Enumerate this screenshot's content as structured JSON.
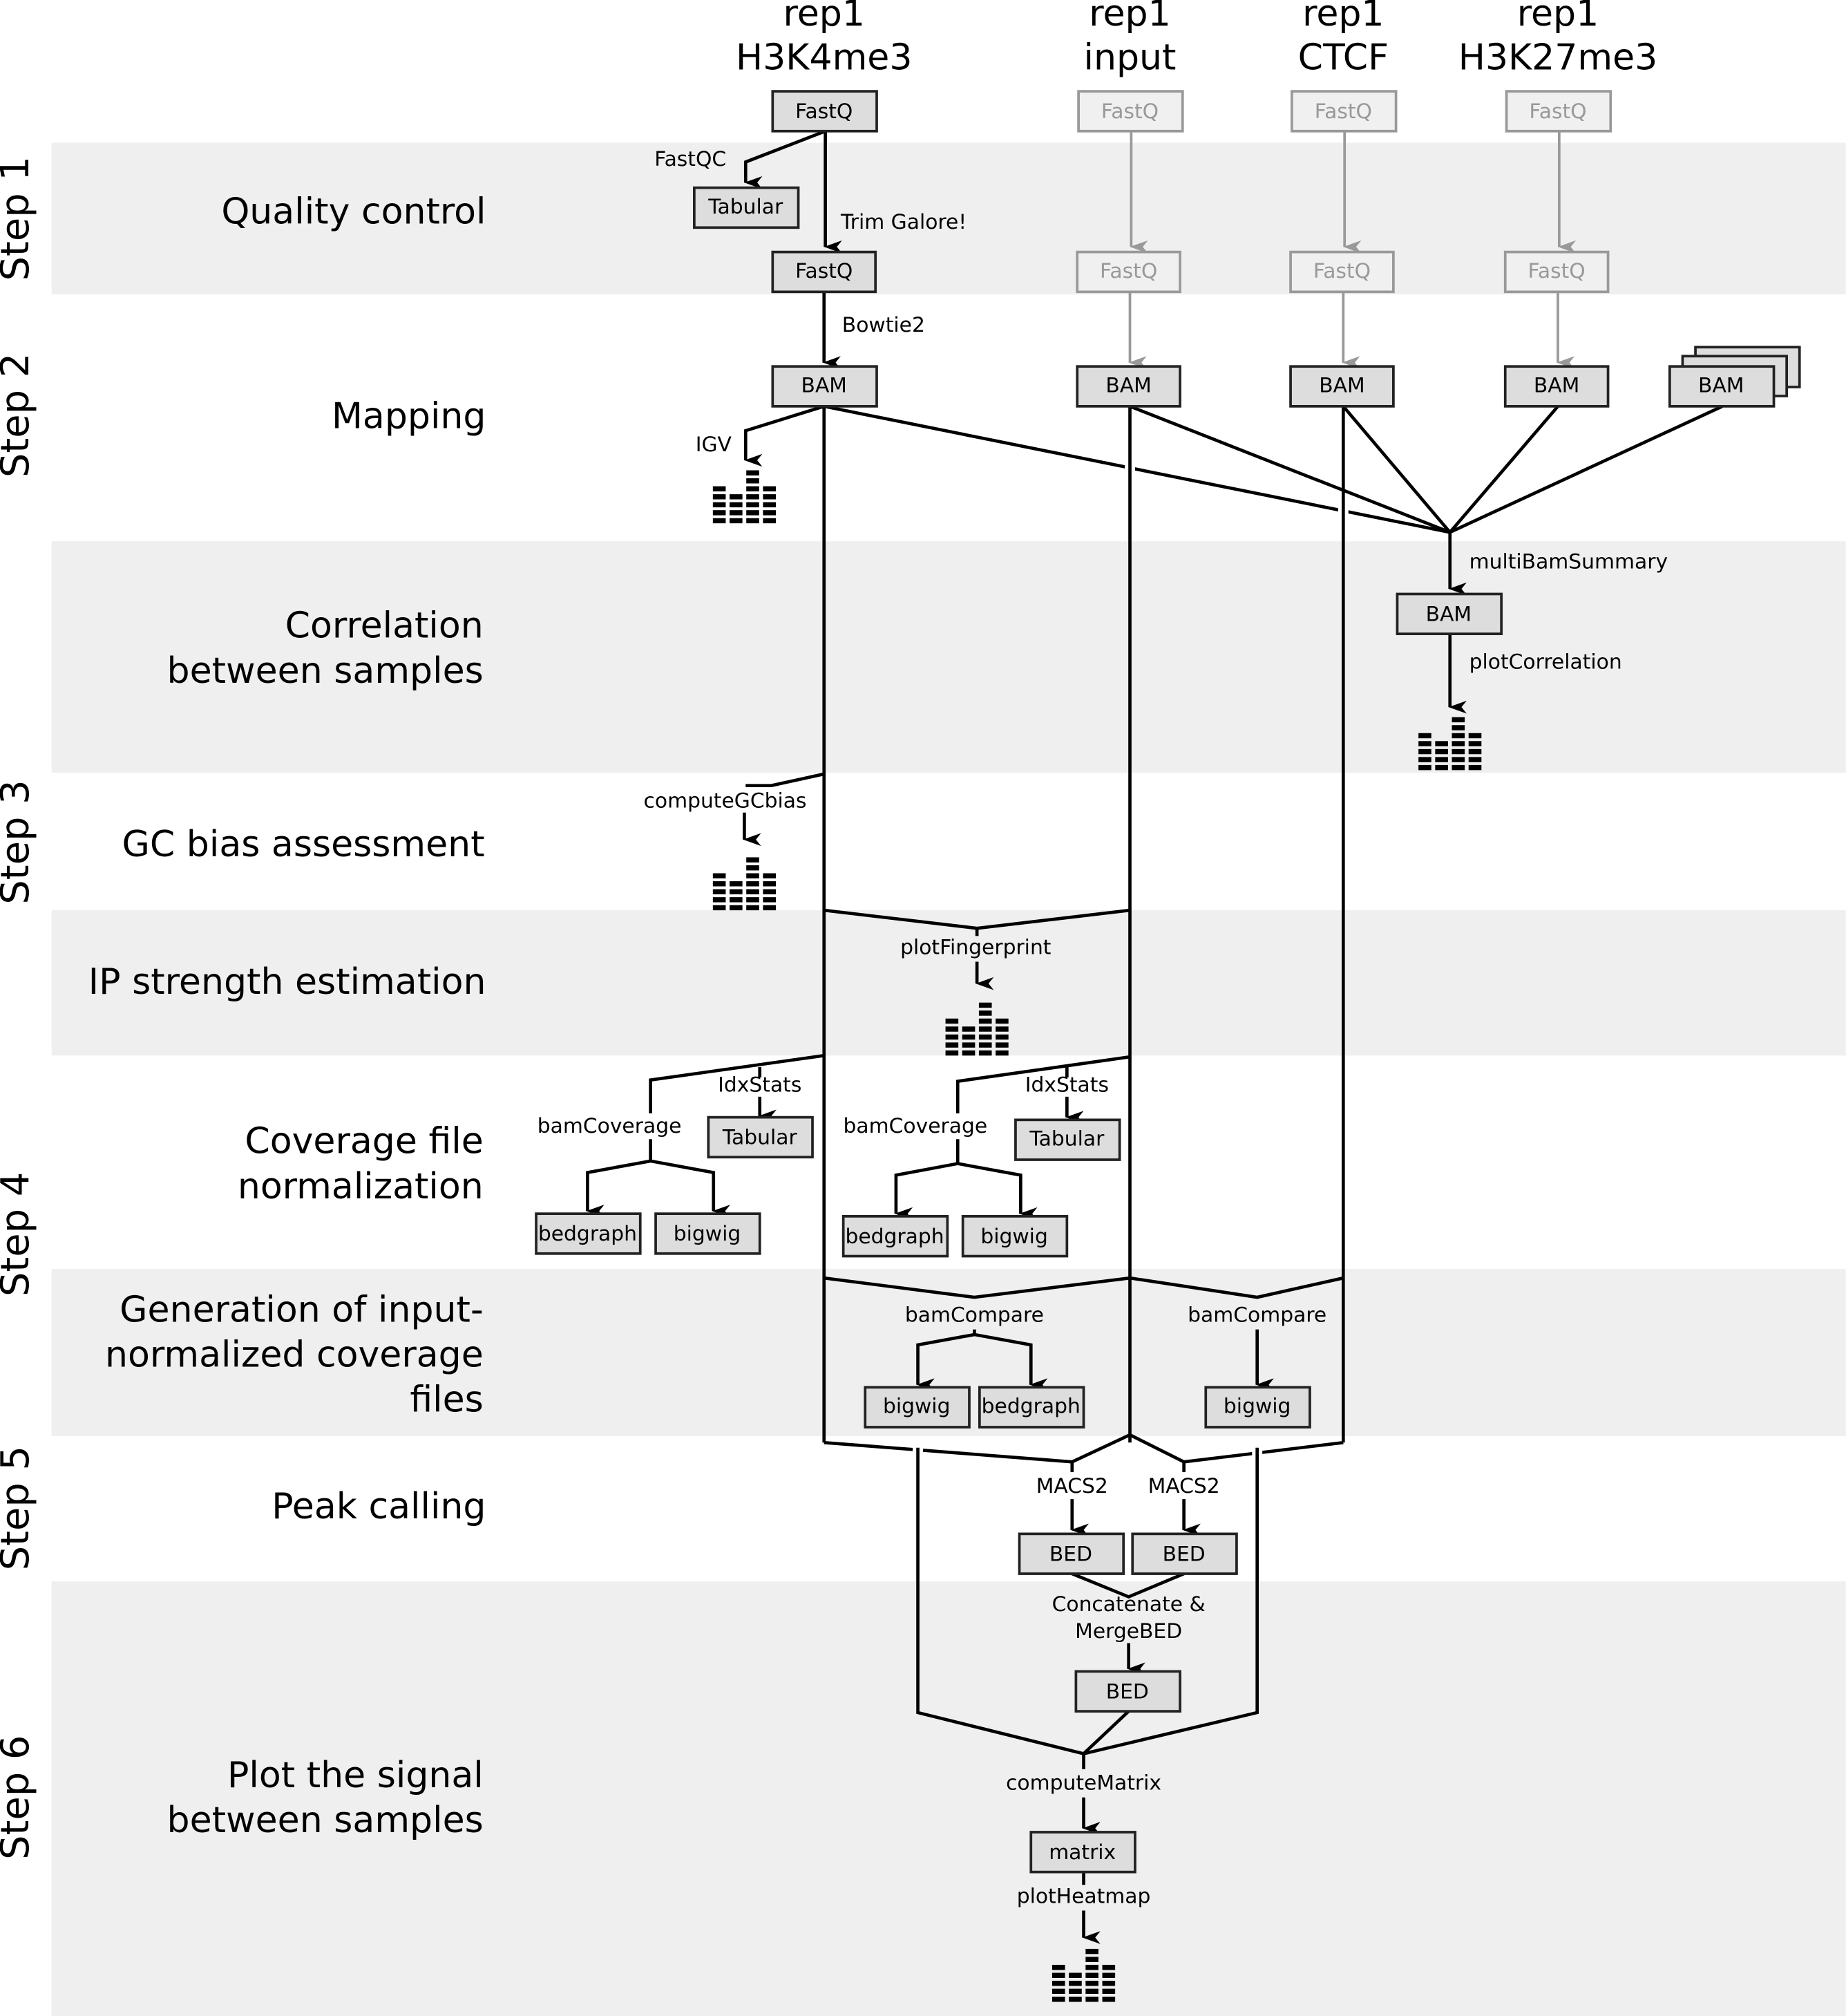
{
  "columns": [
    {
      "line1": "rep1",
      "line2": "H3K4me3"
    },
    {
      "line1": "rep1",
      "line2": "input"
    },
    {
      "line1": "rep1",
      "line2": "CTCF"
    },
    {
      "line1": "rep1",
      "line2": "H3K27me3"
    }
  ],
  "steps": [
    {
      "label": "Step 1"
    },
    {
      "label": "Step 2"
    },
    {
      "label": "Step 3"
    },
    {
      "label": "Step 4"
    },
    {
      "label": "Step 5"
    },
    {
      "label": "Step 6"
    }
  ],
  "sections": [
    {
      "lines": [
        "Quality control"
      ]
    },
    {
      "lines": [
        "Mapping"
      ]
    },
    {
      "lines": [
        "Correlation",
        "between samples"
      ]
    },
    {
      "lines": [
        "GC bias assessment"
      ]
    },
    {
      "lines": [
        "IP strength estimation"
      ]
    },
    {
      "lines": [
        "Coverage file",
        "normalization"
      ]
    },
    {
      "lines": [
        "Generation of input-",
        "normalized coverage",
        "files"
      ]
    },
    {
      "lines": [
        "Peak calling"
      ]
    },
    {
      "lines": [
        "Plot the signal",
        "between samples"
      ]
    }
  ],
  "nodes": {
    "fastq": "FastQ",
    "tabular": "Tabular",
    "bam": "BAM",
    "bedgraph": "bedgraph",
    "bigwig": "bigwig",
    "bed": "BED",
    "matrix": "matrix"
  },
  "tools": {
    "fastqc": "FastQC",
    "trim_galore": "Trim Galore!",
    "bowtie2": "Bowtie2",
    "igv": "IGV",
    "multibamsummary": "multiBamSummary",
    "plotcorrelation": "plotCorrelation",
    "computegcbias": "computeGCbias",
    "plotfingerprint": "plotFingerprint",
    "idxstats": "IdxStats",
    "bamcoverage": "bamCoverage",
    "bamcompare": "bamCompare",
    "macs2": "MACS2",
    "concatenate_line1": "Concatenate &",
    "concatenate_line2": "MergeBED",
    "computematrix": "computeMatrix",
    "plotheatmap": "plotHeatmap"
  },
  "plot_icon": {
    "name": "bar-chart-icon",
    "column_blocks": [
      5,
      4,
      7,
      5
    ]
  },
  "colors": {
    "band": "#efefef",
    "node_fill": "#dddddd",
    "faded": "#999999"
  }
}
